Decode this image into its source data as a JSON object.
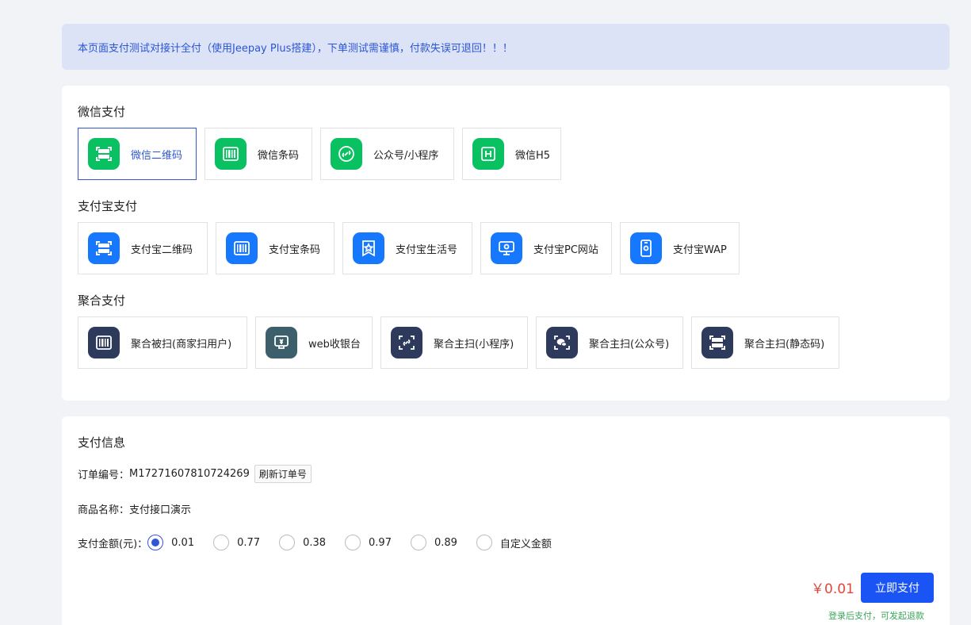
{
  "notice": "本页面支付测试对接计全付（使用Jeepay Plus搭建），下单测试需谨慎，付款失误可退回！！！",
  "colors": {
    "wechat": "#09c160",
    "alipay": "#1677ff",
    "aggregate": "#2e3a5c",
    "web_cashier": "#3d5f6b",
    "accent": "#3057d5",
    "pay_button": "#1b54f5",
    "amount": "#e2453c",
    "tip": "#3aa65a"
  },
  "sections": {
    "wechat": {
      "title": "微信支付",
      "items": [
        {
          "label": "微信二维码",
          "icon": "qr-scan-icon"
        },
        {
          "label": "微信条码",
          "icon": "barcode-icon"
        },
        {
          "label": "公众号/小程序",
          "icon": "miniprogram-icon"
        },
        {
          "label": "微信H5",
          "icon": "h5-icon"
        }
      ]
    },
    "alipay": {
      "title": "支付宝支付",
      "items": [
        {
          "label": "支付宝二维码",
          "icon": "qr-scan-icon"
        },
        {
          "label": "支付宝条码",
          "icon": "barcode-icon"
        },
        {
          "label": "支付宝生活号",
          "icon": "star-badge-icon"
        },
        {
          "label": "支付宝PC网站",
          "icon": "monitor-icon"
        },
        {
          "label": "支付宝WAP",
          "icon": "mobile-icon"
        }
      ]
    },
    "aggregate": {
      "title": "聚合支付",
      "items": [
        {
          "label": "聚合被扫(商家扫用户)",
          "icon": "barcode-icon"
        },
        {
          "label": "web收银台",
          "icon": "cashier-icon"
        },
        {
          "label": "聚合主扫(小程序)",
          "icon": "scan-link-icon"
        },
        {
          "label": "聚合主扫(公众号)",
          "icon": "scan-wechat-icon"
        },
        {
          "label": "聚合主扫(静态码)",
          "icon": "qr-scan-icon"
        }
      ]
    }
  },
  "info": {
    "title": "支付信息",
    "order_label": "订单编号：",
    "order_no": "M17271607810724269",
    "refresh_label": "刷新订单号",
    "product_label": "商品名称：",
    "product_name": "支付接口演示",
    "amount_label": "支付金额(元)：",
    "amount_options": [
      "0.01",
      "0.77",
      "0.38",
      "0.97",
      "0.89",
      "自定义金额"
    ],
    "selected_amount": "0.01",
    "display_amount": "￥0.01",
    "pay_button": "立即支付",
    "pay_tip": "登录后支付，可发起退款"
  }
}
